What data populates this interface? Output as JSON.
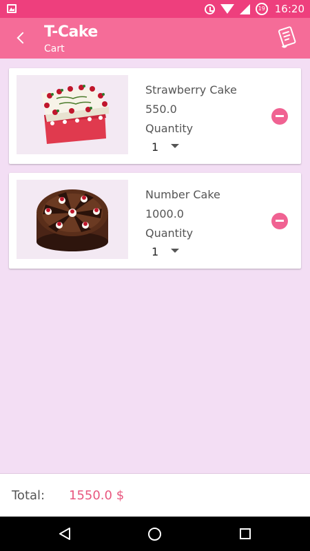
{
  "status_bar": {
    "time": "16:20",
    "battery_level": "19",
    "icons": [
      "image-icon",
      "alarm-icon",
      "wifi-icon",
      "signal-icon",
      "battery-icon"
    ]
  },
  "app_bar": {
    "title": "T-Cake",
    "subtitle": "Cart",
    "icons": [
      "back-arrow-icon",
      "order-list-icon"
    ]
  },
  "cart": {
    "quantity_label": "Quantity",
    "items": [
      {
        "name": "Strawberry Cake",
        "price": "550.0",
        "quantity": "1",
        "image": "strawberry-cake-image"
      },
      {
        "name": "Number Cake",
        "price": "1000.0",
        "quantity": "1",
        "image": "chocolate-cake-image"
      }
    ]
  },
  "total": {
    "label": "Total:",
    "value": "1550.0 $"
  },
  "colors": {
    "status_bar": "#ee3f7d",
    "app_bar": "#f56c98",
    "background": "#f3def4",
    "accent": "#f06292",
    "total_value": "#e8577f"
  },
  "nav_bar": {
    "icons": [
      "nav-back-icon",
      "nav-home-icon",
      "nav-recents-icon"
    ]
  }
}
